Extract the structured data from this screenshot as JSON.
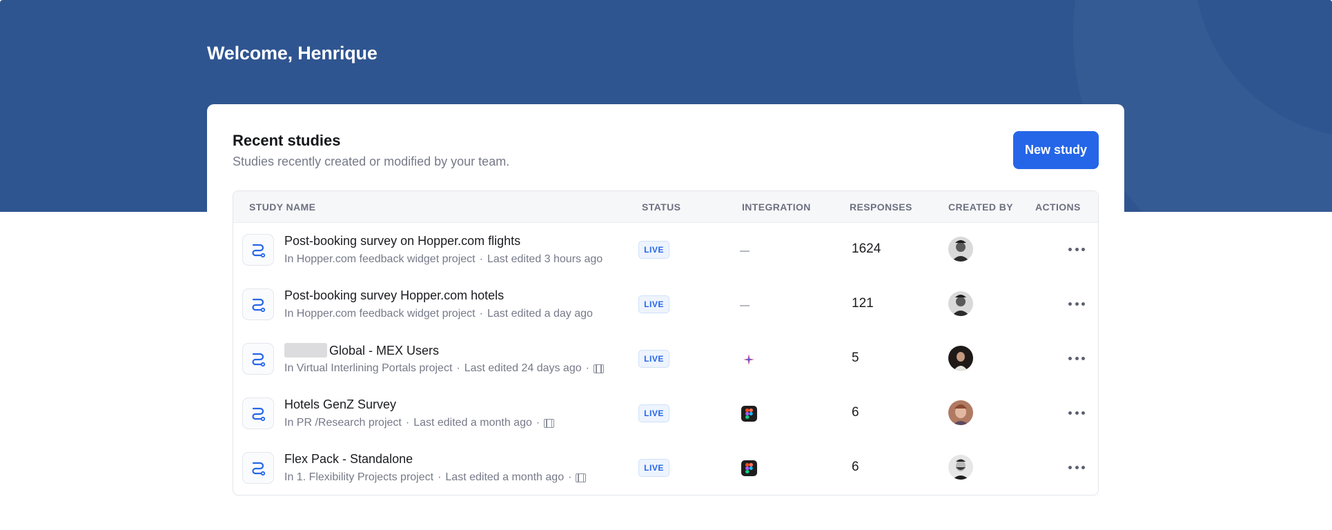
{
  "welcome": "Welcome, Henrique",
  "card": {
    "title": "Recent studies",
    "subtitle": "Studies recently created or modified by your team.",
    "new_button": "New study"
  },
  "columns": {
    "name": "STUDY NAME",
    "status": "STATUS",
    "integration": "INTEGRATION",
    "responses": "RESPONSES",
    "created_by": "CREATED BY",
    "actions": "ACTIONS"
  },
  "rows": [
    {
      "name": "Post-booking survey on Hopper.com flights",
      "project": "In Hopper.com feedback widget project",
      "edited": "Last edited 3 hours ago",
      "status": "LIVE",
      "integration": "none",
      "responses": "1624",
      "avatar_color": "#2b2b2b"
    },
    {
      "name": "Post-booking survey Hopper.com hotels",
      "project": "In Hopper.com feedback widget project",
      "edited": "Last edited a day ago",
      "status": "LIVE",
      "integration": "none",
      "responses": "121",
      "avatar_color": "#2b2b2b"
    },
    {
      "name": "Global - MEX Users",
      "project": "In Virtual Interlining Portals project",
      "edited": "Last edited 24 days ago",
      "status": "LIVE",
      "integration": "sparkle-icon",
      "responses": "5",
      "avatar_color": "#3a2a22"
    },
    {
      "name": "Hotels GenZ Survey",
      "project": "In PR /Research project",
      "edited": "Last edited a month ago",
      "status": "LIVE",
      "integration": "figma-icon",
      "responses": "6",
      "avatar_color": "#b07a62"
    },
    {
      "name": "Flex Pack - Standalone",
      "project": "In 1. Flexibility Projects project",
      "edited": "Last edited a month ago",
      "status": "LIVE",
      "integration": "figma-icon",
      "responses": "6",
      "avatar_color": "#d6d6d6"
    }
  ],
  "colors": {
    "hero": "#2f5590",
    "accent": "#2566e8"
  }
}
